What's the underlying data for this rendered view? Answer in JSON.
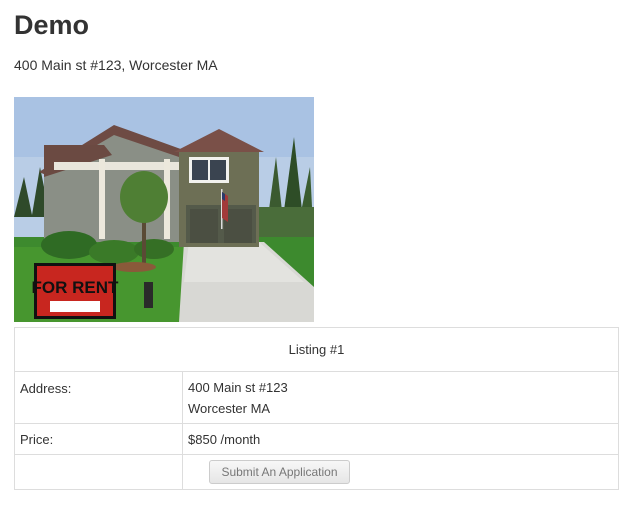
{
  "header": {
    "title": "Demo",
    "address": "400 Main st #123, Worcester MA"
  },
  "photo": {
    "sign_text": "FOR RENT"
  },
  "listing": {
    "caption": "Listing #1",
    "address_label": "Address:",
    "address_line1": "400 Main st #123",
    "address_line2": "Worcester MA",
    "price_label": "Price:",
    "price_value": "$850 /month",
    "apply_button": "Submit An Application"
  }
}
